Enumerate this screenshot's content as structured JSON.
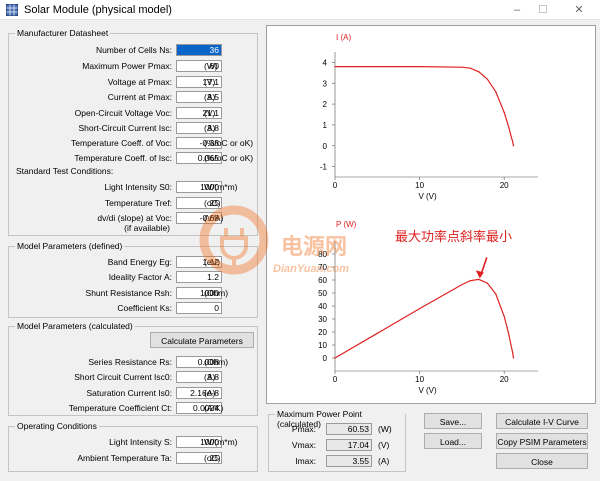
{
  "window": {
    "title": "Solar Module (physical model)",
    "minimize": "–",
    "maximize": "☐",
    "close": "✕"
  },
  "manufacturer": {
    "title": "Manufacturer Datasheet",
    "rows": [
      {
        "label": "Number of Cells Ns:",
        "value": "36",
        "unit": ""
      },
      {
        "label": "Maximum Power Pmax:",
        "value": "60",
        "unit": "(W)"
      },
      {
        "label": "Voltage at Pmax:",
        "value": "17.1",
        "unit": "(V)"
      },
      {
        "label": "Current at Pmax:",
        "value": "3.5",
        "unit": "(A)"
      },
      {
        "label": "Open-Circuit Voltage Voc:",
        "value": "21.1",
        "unit": "(V)"
      },
      {
        "label": "Short-Circuit Current Isc:",
        "value": "3.8",
        "unit": "(A)"
      },
      {
        "label": "Temperature Coeff. of Voc:",
        "value": "-0.38",
        "unit": "(%/oC or oK)"
      },
      {
        "label": "Temperature Coeff. of Isc:",
        "value": "0.065",
        "unit": "(%/oC or oK)"
      }
    ],
    "stc_label": "Standard Test Conditions:",
    "stc_rows": [
      {
        "label": "Light Intensity S0:",
        "value": "1000",
        "unit": "W/(m*m)"
      },
      {
        "label": "Temperature Tref:",
        "value": "25",
        "unit": "(oC)"
      },
      {
        "label": "dv/di (slope) at Voc:",
        "value": "-0.68",
        "unit": "(V/A)"
      }
    ],
    "if_available": "(if available)"
  },
  "defined": {
    "title": "Model Parameters (defined)",
    "rows": [
      {
        "label": "Band Energy Eg:",
        "value": "1.12",
        "unit": "(eV)"
      },
      {
        "label": "Ideality Factor A:",
        "value": "1.2",
        "unit": ""
      },
      {
        "label": "Shunt Resistance Rsh:",
        "value": "1000",
        "unit": "(Ohm)"
      },
      {
        "label": "Coefficient Ks:",
        "value": "0",
        "unit": ""
      }
    ]
  },
  "calculated": {
    "title": "Model Parameters (calculated)",
    "button": "Calculate Parameters",
    "rows": [
      {
        "label": "Series Resistance Rs:",
        "value": "0.008",
        "unit": "(Ohm)"
      },
      {
        "label": "Short Circuit Current Isc0:",
        "value": "3.8",
        "unit": "(A)"
      },
      {
        "label": "Saturation Current Is0:",
        "value": "2.16e-8",
        "unit": "(A)"
      },
      {
        "label": "Temperature Coefficient Ct:",
        "value": "0.0024",
        "unit": "(A/K)"
      }
    ]
  },
  "operating": {
    "title": "Operating Conditions",
    "rows": [
      {
        "label": "Light Intensity S:",
        "value": "1000",
        "unit": "W/(m*m)"
      },
      {
        "label": "Ambient Temperature Ta:",
        "value": "25",
        "unit": "(oC)"
      }
    ]
  },
  "mpp": {
    "title": "Maximum Power Point (calculated)",
    "rows": [
      {
        "label": "Pmax:",
        "value": "60.53",
        "unit": "(W)"
      },
      {
        "label": "Vmax:",
        "value": "17.04",
        "unit": "(V)"
      },
      {
        "label": "Imax:",
        "value": "3.55",
        "unit": "(A)"
      }
    ]
  },
  "buttons": {
    "save": "Save...",
    "load": "Load...",
    "calc_iv": "Calculate I-V Curve",
    "copy_psim": "Copy PSIM Parameters",
    "close": "Close"
  },
  "watermark": {
    "cn": "电源网",
    "en": "DianYuan.com"
  },
  "annotation": "最大功率点斜率最小",
  "colors": {
    "curve": "#e02020",
    "annotation": "#e02020"
  },
  "chart_data": [
    {
      "type": "line",
      "ylabel": "I (A)",
      "xlabel": "V (V)",
      "xlim": [
        0,
        24
      ],
      "ylim": [
        -1.5,
        4.5
      ],
      "xticks": [
        "0",
        "10",
        "20"
      ],
      "yticks": [
        "-1",
        "0",
        "1",
        "2",
        "3",
        "4"
      ],
      "grid": false,
      "x": [
        0,
        10,
        15,
        16,
        17,
        18,
        19,
        20,
        20.5,
        21,
        21.1
      ],
      "y": [
        3.8,
        3.8,
        3.77,
        3.72,
        3.55,
        3.2,
        2.6,
        1.6,
        0.95,
        0.2,
        0.0
      ]
    },
    {
      "type": "line",
      "ylabel": "P (W)",
      "xlabel": "V (V)",
      "xlim": [
        0,
        24
      ],
      "ylim": [
        -10,
        90
      ],
      "xticks": [
        "0",
        "10",
        "20"
      ],
      "yticks": [
        "0",
        "10",
        "20",
        "30",
        "40",
        "50",
        "60",
        "70",
        "80"
      ],
      "grid": false,
      "x": [
        0,
        5,
        10,
        15,
        16,
        17,
        18,
        19,
        20,
        20.5,
        21,
        21.1
      ],
      "y": [
        0,
        19,
        38,
        56.5,
        59.5,
        60.5,
        57.6,
        49.4,
        32,
        19.5,
        4.2,
        0
      ]
    }
  ]
}
